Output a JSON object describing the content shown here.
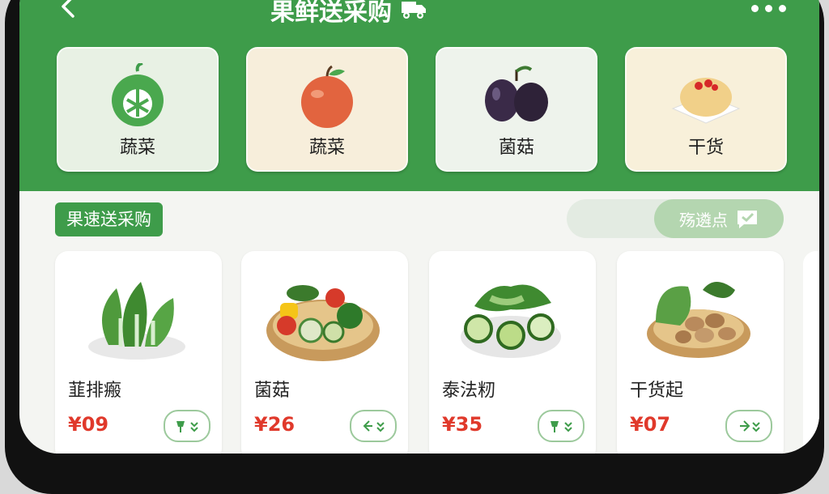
{
  "header": {
    "title": "果鲜送采购"
  },
  "categories": [
    {
      "label": "蔬菜",
      "bg": "#e8f1e4",
      "icon": "green-fruit-icon"
    },
    {
      "label": "蔬菜",
      "bg": "#f7eedb",
      "icon": "apple-icon"
    },
    {
      "label": "菌菇",
      "bg": "#eef3ec",
      "icon": "plum-icon"
    },
    {
      "label": "干货",
      "bg": "#f8f0da",
      "icon": "bun-icon"
    }
  ],
  "section": {
    "tag": "果速送采购",
    "filter_label": "殇遴点"
  },
  "products": [
    {
      "name": "韮排瘢",
      "price": "¥09"
    },
    {
      "name": "菌菇",
      "price": "¥26"
    },
    {
      "name": "泰法籾",
      "price": "¥35"
    },
    {
      "name": "干货起",
      "price": "¥07"
    }
  ],
  "colors": {
    "brand_green": "#3e9c4a",
    "price_red": "#e0392b"
  }
}
